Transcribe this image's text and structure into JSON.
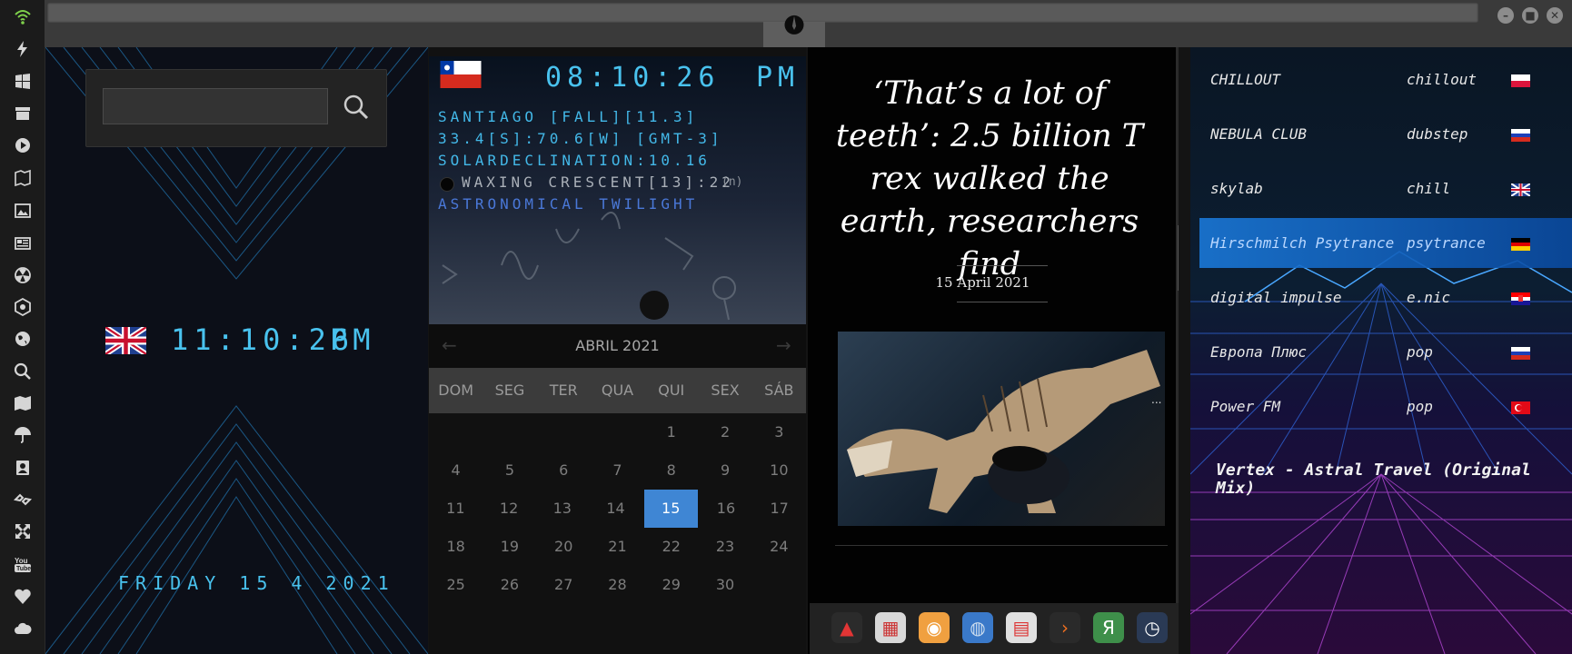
{
  "window": {
    "min_label": "–",
    "max_label": "■",
    "close_label": "✕"
  },
  "left_icons": [
    "wifi-icon",
    "lightning-icon",
    "windows-icon",
    "archive-icon",
    "play-icon",
    "map-book-icon",
    "image-icon",
    "news-icon",
    "radiation-icon",
    "hexagon-icon",
    "globe-icon",
    "search-icon",
    "map-icon",
    "umbrella-icon",
    "contacts-icon",
    "link-icon",
    "expand-icon",
    "youtube-icon",
    "heart-icon",
    "cloud-icon"
  ],
  "panel1": {
    "search_value": "",
    "clock_time": "11:10:26",
    "clock_ampm": "PM",
    "date_text": "FRIDAY 15 4 2021"
  },
  "panel2": {
    "clock_time": "08:10:26",
    "clock_ampm": "PM",
    "line1": "SANTIAGO [FALL][11.3]",
    "line2": "33.4[S]:70.6[W] [GMT-3]",
    "line3": "SOLARDECLINATION:10.16",
    "line4": "WAXING CRESCENT[13]:22",
    "line4_suffix": "(n)",
    "line5": "ASTRONOMICAL TWILIGHT",
    "month": "ABRIL 2021",
    "prev": "←",
    "next": "→",
    "weekdays": [
      "DOM",
      "SEG",
      "TER",
      "QUA",
      "QUI",
      "SEX",
      "SÁB"
    ],
    "weeks": [
      [
        "",
        "",
        "",
        "",
        "1",
        "2",
        "3"
      ],
      [
        "4",
        "5",
        "6",
        "7",
        "8",
        "9",
        "10"
      ],
      [
        "11",
        "12",
        "13",
        "14",
        "15",
        "16",
        "17"
      ],
      [
        "18",
        "19",
        "20",
        "21",
        "22",
        "23",
        "24"
      ],
      [
        "25",
        "26",
        "27",
        "28",
        "29",
        "30",
        ""
      ]
    ],
    "today": "15"
  },
  "panel3": {
    "headline": "‘That’s a lot of teeth’: 2.5 billion T rex walked the earth, researchers find",
    "date": "15 April 2021",
    "image_more": "..."
  },
  "panel4": {
    "stations": [
      {
        "name": "CHILLOUT",
        "genre": "chillout",
        "flag": "poland-flag"
      },
      {
        "name": "NEBULA CLUB",
        "genre": "dubstep",
        "flag": "russia-flag"
      },
      {
        "name": "skylab",
        "genre": "chill",
        "flag": "uk-flag"
      },
      {
        "name": "Hirschmilch Psytrance",
        "genre": "psytrance",
        "flag": "germany-flag"
      },
      {
        "name": "digital impulse",
        "genre": "e.nic",
        "flag": "croatia-flag"
      },
      {
        "name": "Европа Плюс",
        "genre": "pop",
        "flag": "russia-flag"
      },
      {
        "name": "Power FM",
        "genre": "pop",
        "flag": "turkey-flag"
      }
    ],
    "now_playing": "Vertex - Astral Travel (Original Mix)"
  },
  "colors": {
    "accent_blue": "#3f86d4",
    "digital_cyan": "#49c2ee",
    "dock_bg": "#222222"
  }
}
